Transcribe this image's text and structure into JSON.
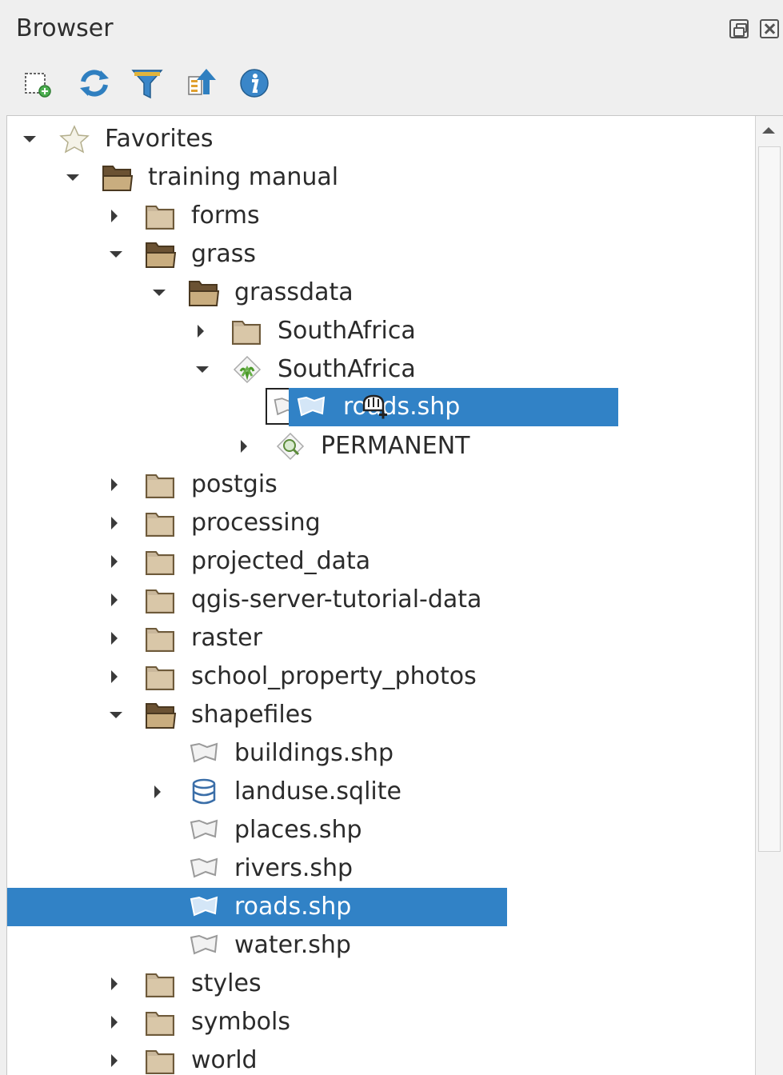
{
  "panel": {
    "title": "Browser"
  },
  "toolbar": {
    "buttons": [
      {
        "icon": "add-layer-icon",
        "name": "add-selected-layers-button"
      },
      {
        "icon": "refresh-icon",
        "name": "refresh-button"
      },
      {
        "icon": "filter-icon",
        "name": "filter-button"
      },
      {
        "icon": "collapse-all-icon",
        "name": "collapse-all-button"
      },
      {
        "icon": "info-icon",
        "name": "properties-button"
      }
    ]
  },
  "tree": {
    "items": [
      {
        "label": "Favorites",
        "icon": "star-icon",
        "expanded": true
      },
      {
        "label": "training manual",
        "icon": "folder-open-icon",
        "expanded": true
      },
      {
        "label": "forms",
        "icon": "folder-icon",
        "expanded": false
      },
      {
        "label": "grass",
        "icon": "folder-open-icon",
        "expanded": true
      },
      {
        "label": "grassdata",
        "icon": "folder-open-icon",
        "expanded": true
      },
      {
        "label": "SouthAfrica",
        "icon": "folder-icon",
        "expanded": false
      },
      {
        "label": "SouthAfrica",
        "icon": "grass-location-icon",
        "expanded": true
      },
      {
        "label": "PERMANENT",
        "icon": "grass-mapset-icon",
        "expanded": false
      },
      {
        "label": "postgis",
        "icon": "folder-icon",
        "expanded": false
      },
      {
        "label": "processing",
        "icon": "folder-icon",
        "expanded": false
      },
      {
        "label": "projected_data",
        "icon": "folder-icon",
        "expanded": false
      },
      {
        "label": "qgis-server-tutorial-data",
        "icon": "folder-icon",
        "expanded": false
      },
      {
        "label": "raster",
        "icon": "folder-icon",
        "expanded": false
      },
      {
        "label": "school_property_photos",
        "icon": "folder-icon",
        "expanded": false
      },
      {
        "label": "shapefiles",
        "icon": "folder-open-icon",
        "expanded": true
      },
      {
        "label": "buildings.shp",
        "icon": "polygon-layer-icon"
      },
      {
        "label": "landuse.sqlite",
        "icon": "database-icon",
        "expanded": false
      },
      {
        "label": "places.shp",
        "icon": "polygon-layer-icon"
      },
      {
        "label": "rivers.shp",
        "icon": "polygon-layer-icon"
      },
      {
        "label": "roads.shp",
        "icon": "polygon-layer-icon",
        "selected": true
      },
      {
        "label": "water.shp",
        "icon": "polygon-layer-icon"
      },
      {
        "label": "styles",
        "icon": "folder-icon",
        "expanded": false
      },
      {
        "label": "symbols",
        "icon": "folder-icon",
        "expanded": false
      },
      {
        "label": "world",
        "icon": "folder-icon",
        "expanded": false
      }
    ],
    "drag": {
      "label": "roads.shp",
      "icon": "polygon-layer-icon",
      "cursor": "drag-hand-icon"
    }
  },
  "colors": {
    "selection": "#3182c6",
    "folder": "#c9b79b"
  }
}
